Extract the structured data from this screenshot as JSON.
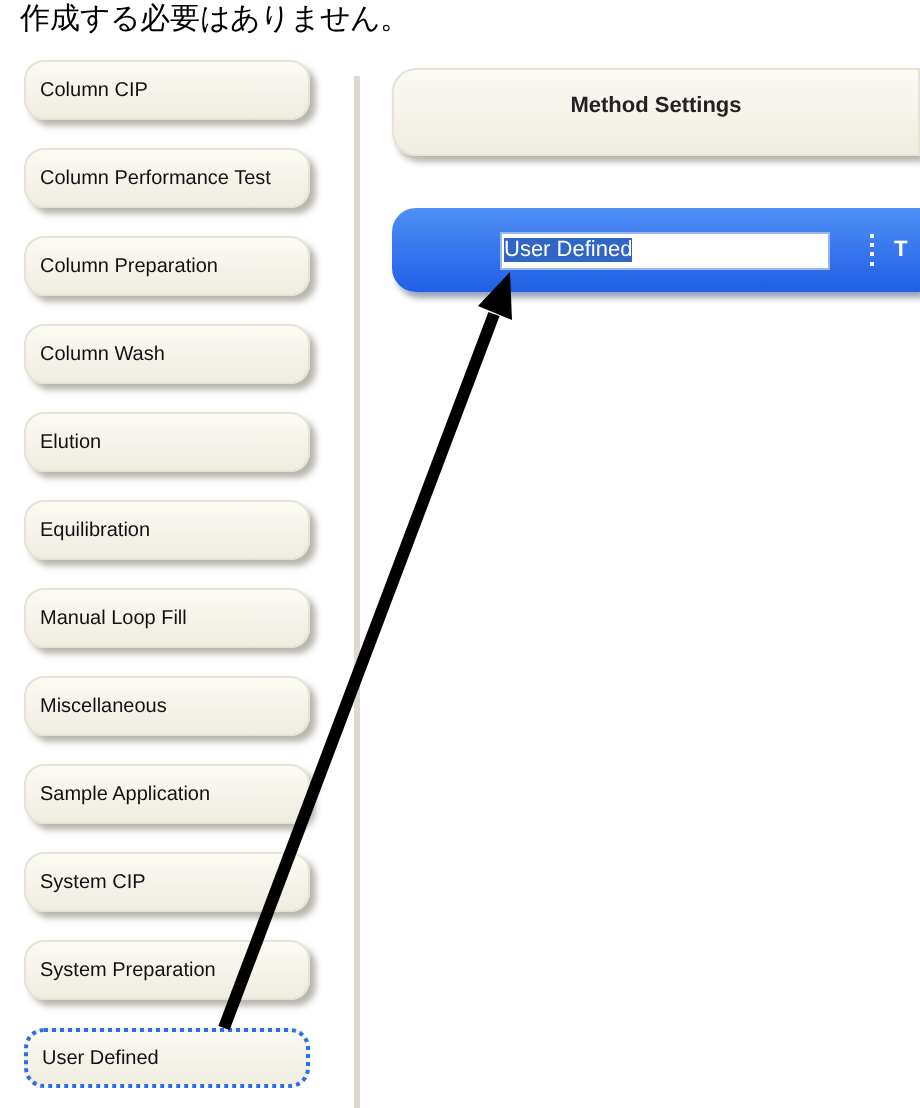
{
  "caption": "作成する必要はありません。",
  "methods": [
    {
      "label": "Column CIP",
      "selected": false
    },
    {
      "label": "Column Performance Test",
      "selected": false
    },
    {
      "label": "Column Preparation",
      "selected": false
    },
    {
      "label": "Column Wash",
      "selected": false
    },
    {
      "label": "Elution",
      "selected": false
    },
    {
      "label": "Equilibration",
      "selected": false
    },
    {
      "label": "Manual Loop Fill",
      "selected": false
    },
    {
      "label": "Miscellaneous",
      "selected": false
    },
    {
      "label": "Sample Application",
      "selected": false
    },
    {
      "label": "System CIP",
      "selected": false
    },
    {
      "label": "System Preparation",
      "selected": false
    },
    {
      "label": "User Defined",
      "selected": true
    }
  ],
  "settings": {
    "title": "Method Settings",
    "name_field": {
      "value": "User Defined",
      "text_selected": true
    },
    "side_label": "T"
  }
}
